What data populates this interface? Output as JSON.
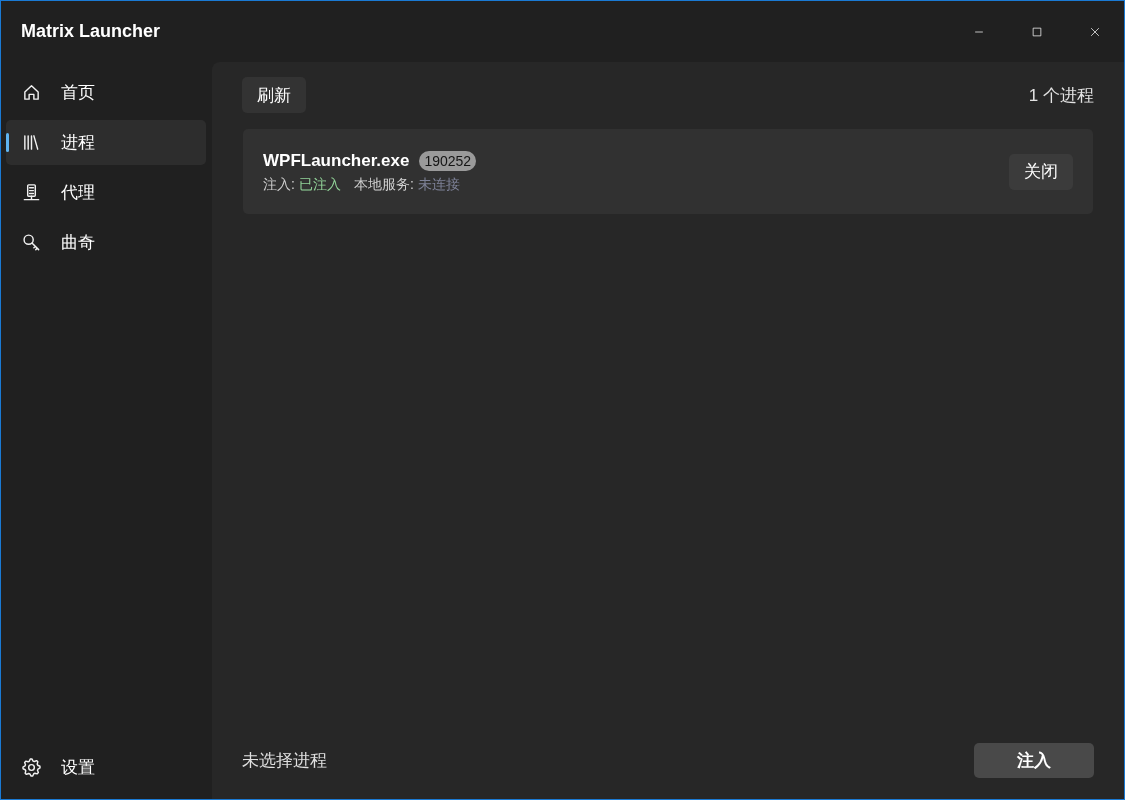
{
  "window": {
    "title": "Matrix Launcher"
  },
  "sidebar": {
    "items": [
      {
        "label": "首页",
        "selected": false
      },
      {
        "label": "进程",
        "selected": true
      },
      {
        "label": "代理",
        "selected": false
      },
      {
        "label": "曲奇",
        "selected": false
      }
    ],
    "footer_item": {
      "label": "设置",
      "selected": false
    }
  },
  "toolbar": {
    "refresh_button": "刷新",
    "process_count": "1 个进程"
  },
  "processes": [
    {
      "name": "WPFLauncher.exe",
      "pid": "190252",
      "inject_label": "注入:",
      "inject_status": "已注入",
      "injected": true,
      "service_label": "本地服务:",
      "service_status": "未连接",
      "connected": false,
      "close_button": "关闭"
    }
  ],
  "footer": {
    "selection": "未选择进程",
    "inject_button": "注入"
  }
}
